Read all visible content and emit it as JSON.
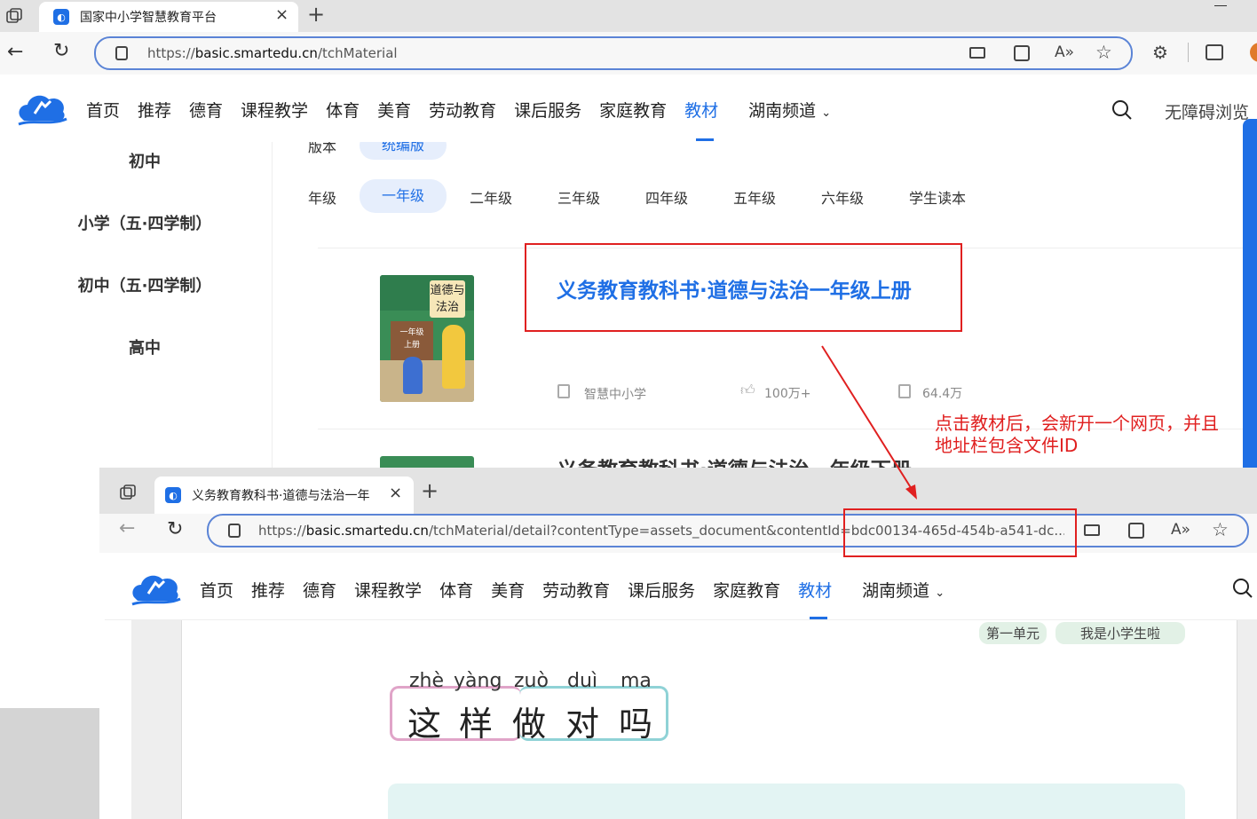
{
  "browser1": {
    "tab_title": "国家中小学智慧教育平台",
    "url_prefix": "https://",
    "url_domain": "basic.smartedu.cn",
    "url_path": "/tchMaterial"
  },
  "site_nav": {
    "items": [
      "首页",
      "推荐",
      "德育",
      "课程教学",
      "体育",
      "美育",
      "劳动教育",
      "课后服务",
      "家庭教育",
      "教材"
    ],
    "active": "教材",
    "region": "湖南频道",
    "accessibility": "无障碍浏览"
  },
  "sidebar": {
    "items": [
      "初中",
      "小学（五·四学制）",
      "初中（五·四学制）",
      "高中"
    ]
  },
  "filters": {
    "version_label": "版本",
    "version_value": "统编版",
    "grade_label": "年级",
    "grades": [
      "一年级",
      "二年级",
      "三年级",
      "四年级",
      "五年级",
      "六年级",
      "学生读本"
    ],
    "active_grade": "一年级"
  },
  "book1": {
    "title": "义务教育教科书·道德与法治一年级上册",
    "publisher": "智慧中小学",
    "likes": "100万+",
    "views": "64.4万",
    "cover_text": "道德与法治",
    "cover_sub1": "一年级",
    "cover_sub2": "上册"
  },
  "book2": {
    "title_partial": "义务教育教科书·道德与法治一年级下册"
  },
  "annotation": {
    "line1": "点击教材后，会新开一个网页，并且",
    "line2": "地址栏包含文件ID"
  },
  "browser2": {
    "tab_title": "义务教育教科书·道德与法治一年",
    "url_prefix": "https://",
    "url_domain": "basic.smartedu.cn",
    "url_path": "/tchMaterial/detail?contentType=assets_document&contentId=bdc00134-465d-454b-a541-dc..."
  },
  "lesson": {
    "unit": "第一单元",
    "unit_title": "我是小学生啦",
    "pinyin": [
      "zhè",
      "yàng",
      "zuò",
      "duì",
      "ma"
    ],
    "chars": [
      "这",
      "样",
      "做",
      "对",
      "吗"
    ]
  },
  "colors": {
    "accent": "#1f6fe5",
    "annotation_red": "#e02020"
  }
}
